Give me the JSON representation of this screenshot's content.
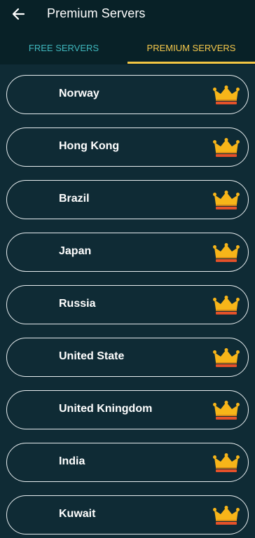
{
  "header": {
    "title": "Premium Servers",
    "back_icon": "arrow-left-icon"
  },
  "tabs": [
    {
      "label": "FREE SERVERS",
      "active": false
    },
    {
      "label": "PREMIUM SERVERS",
      "active": true
    }
  ],
  "servers": [
    {
      "name": "Norway",
      "icon": "crown-icon"
    },
    {
      "name": "Hong Kong",
      "icon": "crown-icon"
    },
    {
      "name": "Brazil",
      "icon": "crown-icon"
    },
    {
      "name": "Japan",
      "icon": "crown-icon"
    },
    {
      "name": "Russia",
      "icon": "crown-icon"
    },
    {
      "name": "United State",
      "icon": "crown-icon"
    },
    {
      "name": "United Kningdom",
      "icon": "crown-icon"
    },
    {
      "name": "India",
      "icon": "crown-icon"
    },
    {
      "name": "Kuwait",
      "icon": "crown-icon"
    }
  ],
  "colors": {
    "background": "#0f2b35",
    "appbar": "#082127",
    "free_tab": "#3fb7bd",
    "premium_tab": "#f5c84b",
    "crown_gold": "#f7b519",
    "crown_base": "#e5512a"
  }
}
